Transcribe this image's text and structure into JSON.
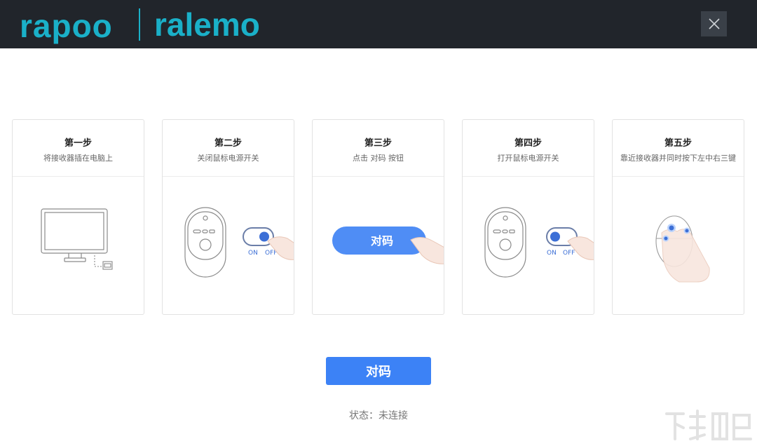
{
  "header": {
    "logo_left": "rapoo",
    "logo_right": "ralemo",
    "close_icon": "close-icon"
  },
  "steps": [
    {
      "title": "第一步",
      "desc": "将接收器插在电脑上"
    },
    {
      "title": "第二步",
      "desc": "关闭鼠标电源开关"
    },
    {
      "title": "第三步",
      "desc": "点击 对码 按钮"
    },
    {
      "title": "第四步",
      "desc": "打开鼠标电源开关"
    },
    {
      "title": "第五步",
      "desc": "靠近接收器并同时按下左中右三键"
    }
  ],
  "illus": {
    "switch_on": "ON",
    "switch_off": "OFF",
    "pair_pill": "对码"
  },
  "pair_button": "对码",
  "status": "状态：未连接",
  "colors": {
    "accent": "#3c82f6",
    "brand": "#1ab0c8",
    "topbar": "#21252b"
  }
}
